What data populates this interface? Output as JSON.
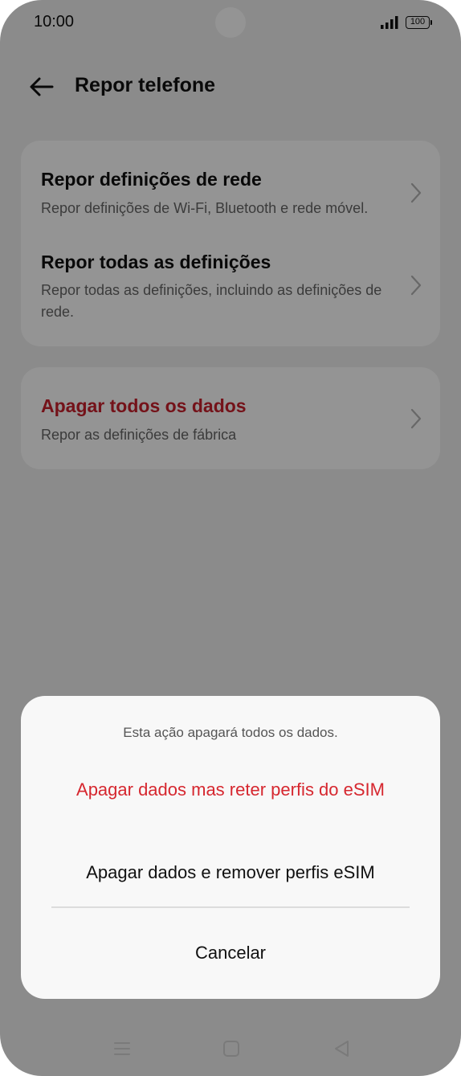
{
  "status_bar": {
    "time": "10:00",
    "battery": "100"
  },
  "header": {
    "title": "Repor telefone"
  },
  "settings": {
    "network": {
      "title": "Repor definições de rede",
      "subtitle": "Repor definições de Wi-Fi, Bluetooth e rede móvel."
    },
    "all_settings": {
      "title": "Repor todas as definições",
      "subtitle": "Repor todas as definições, incluindo as definições de rede."
    },
    "erase_all": {
      "title": "Apagar todos os dados",
      "subtitle": "Repor as definições de fábrica"
    }
  },
  "dialog": {
    "message": "Esta ação apagará todos os dados.",
    "keep_esim_label": "Apagar dados mas reter perfis do eSIM",
    "remove_esim_label": "Apagar dados e remover perfis eSIM",
    "cancel_label": "Cancelar"
  },
  "nav_bar": {
    "icons": [
      "menu-icon",
      "home-icon",
      "back-icon"
    ]
  },
  "colors": {
    "accent_red": "#d6272f",
    "danger_title": "#c8202c",
    "overlay": "rgba(0,0,0,0.42)"
  }
}
